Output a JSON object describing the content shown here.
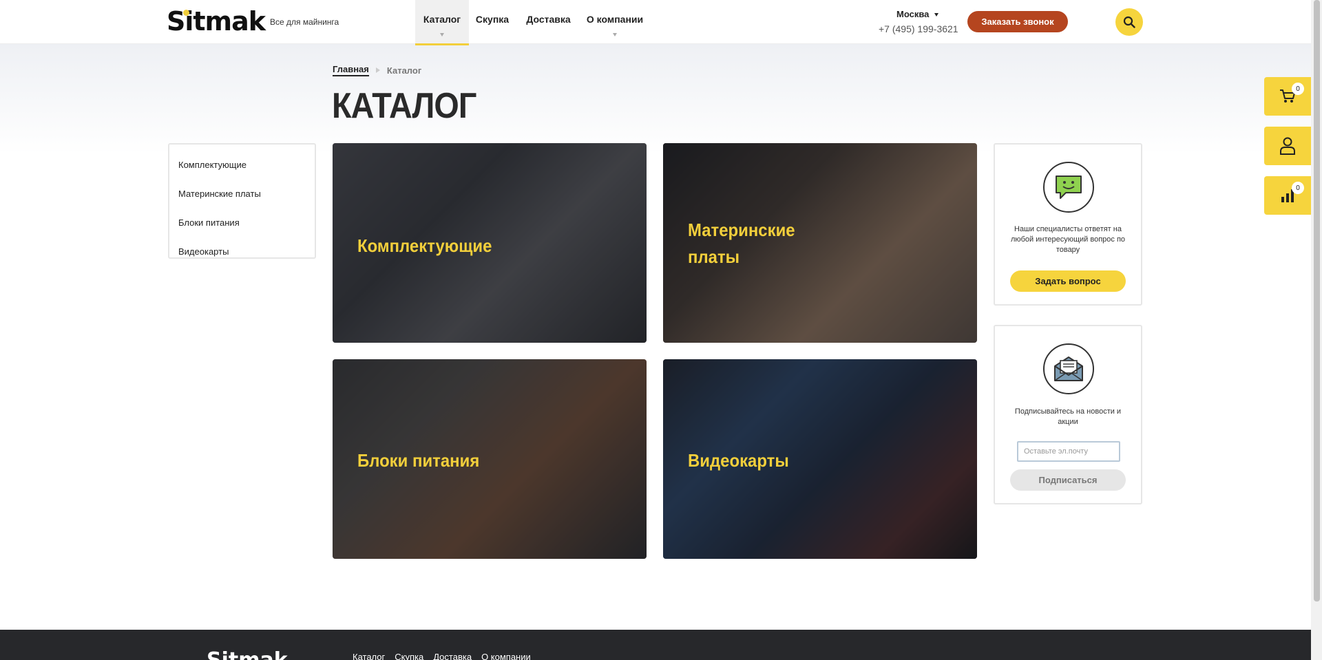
{
  "header": {
    "logo": "Sitmak",
    "tagline": "Все для майнинга",
    "nav": [
      {
        "label": "Каталог",
        "active": true
      },
      {
        "label": "Скупка"
      },
      {
        "label": "Доставка"
      },
      {
        "label": "О компании"
      }
    ],
    "city": "Москва",
    "phone": "+7 (495) 199-3621",
    "call_button": "Заказать звонок",
    "search_icon": "search-icon"
  },
  "breadcrumb": {
    "home": "Главная",
    "current": "Каталог"
  },
  "page_title": "КАТАЛОГ",
  "sidebar": {
    "items": [
      {
        "label": "Комплектующие"
      },
      {
        "label": "Материнские платы"
      },
      {
        "label": "Блоки питания"
      },
      {
        "label": "Видеокарты"
      }
    ]
  },
  "categories": [
    {
      "title": "Комплектующие"
    },
    {
      "title_line1": "Материнские",
      "title_line2": "платы"
    },
    {
      "title": "Блоки питания"
    },
    {
      "title": "Видеокарты"
    }
  ],
  "ask_card": {
    "icon": "chat-smile-icon",
    "text": "Наши специалисты ответят на любой интересующий вопрос по товару",
    "button": "Задать вопрос"
  },
  "subscribe_card": {
    "icon": "envelope-icon",
    "text": "Подписывайтесь на новости и акции",
    "placeholder": "Оставьте эл.почту",
    "button": "Подписаться"
  },
  "fixed_buttons": {
    "cart_count": "0",
    "compare_count": "0"
  },
  "footer": {
    "logo": "Sitmak",
    "links": [
      "Каталог",
      "Скупка",
      "Доставка",
      "О компании"
    ]
  },
  "colors": {
    "accent": "#f6d43d",
    "call": "#b5451f",
    "title_yellow": "#f2cf3b",
    "footer": "#27282b"
  }
}
